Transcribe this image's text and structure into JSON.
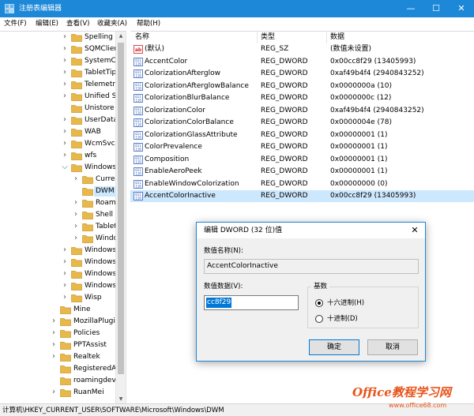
{
  "window": {
    "title": "注册表编辑器",
    "minimize": "—",
    "maximize": "☐",
    "close": "✕"
  },
  "menu": [
    "文件(F)",
    "编辑(E)",
    "查看(V)",
    "收藏夹(A)",
    "帮助(H)"
  ],
  "tree": {
    "items": [
      {
        "label": "Spelling",
        "level": 1,
        "expander": "right"
      },
      {
        "label": "SQMClient",
        "level": 1,
        "expander": "right"
      },
      {
        "label": "SystemCertifi",
        "level": 1,
        "expander": "right"
      },
      {
        "label": "TabletTip",
        "level": 1,
        "expander": "right"
      },
      {
        "label": "TelemetryClie",
        "level": 1,
        "expander": "right"
      },
      {
        "label": "Unified Store",
        "level": 1,
        "expander": "right"
      },
      {
        "label": "Unistore",
        "level": 1,
        "expander": "none"
      },
      {
        "label": "UserData",
        "level": 1,
        "expander": "right"
      },
      {
        "label": "WAB",
        "level": 1,
        "expander": "right"
      },
      {
        "label": "WcmSvc",
        "level": 1,
        "expander": "right"
      },
      {
        "label": "wfs",
        "level": 1,
        "expander": "right"
      },
      {
        "label": "Windows",
        "level": 1,
        "expander": "down"
      },
      {
        "label": "CurrentVe",
        "level": 2,
        "expander": "right"
      },
      {
        "label": "DWM",
        "level": 2,
        "expander": "none",
        "selected": true
      },
      {
        "label": "Roaming",
        "level": 2,
        "expander": "right"
      },
      {
        "label": "Shell",
        "level": 2,
        "expander": "right"
      },
      {
        "label": "TabletPC",
        "level": 2,
        "expander": "right"
      },
      {
        "label": "Windows",
        "level": 2,
        "expander": "right"
      },
      {
        "label": "Windows NT",
        "level": 1,
        "expander": "right"
      },
      {
        "label": "Windows Scr",
        "level": 1,
        "expander": "right"
      },
      {
        "label": "Windows Sea",
        "level": 1,
        "expander": "right"
      },
      {
        "label": "WindowsSelf",
        "level": 1,
        "expander": "right"
      },
      {
        "label": "Wisp",
        "level": 1,
        "expander": "right"
      },
      {
        "label": "Mine",
        "level": 0,
        "expander": "none"
      },
      {
        "label": "MozillaPlugins",
        "level": 0,
        "expander": "right"
      },
      {
        "label": "Policies",
        "level": 0,
        "expander": "right"
      },
      {
        "label": "PPTAssist",
        "level": 0,
        "expander": "right"
      },
      {
        "label": "Realtek",
        "level": 0,
        "expander": "right"
      },
      {
        "label": "RegisteredApplic",
        "level": 0,
        "expander": "none"
      },
      {
        "label": "roamingdevice",
        "level": 0,
        "expander": "none"
      },
      {
        "label": "RuanMei",
        "level": 0,
        "expander": "right"
      }
    ]
  },
  "list": {
    "headers": {
      "name": "名称",
      "type": "类型",
      "data": "数据"
    },
    "rows": [
      {
        "name": "(默认)",
        "type": "REG_SZ",
        "data": "(数值未设置)",
        "icon": "string-value-icon"
      },
      {
        "name": "AccentColor",
        "type": "REG_DWORD",
        "data": "0x00cc8f29 (13405993)",
        "icon": "binary-value-icon"
      },
      {
        "name": "ColorizationAfterglow",
        "type": "REG_DWORD",
        "data": "0xaf49b4f4 (2940843252)",
        "icon": "binary-value-icon"
      },
      {
        "name": "ColorizationAfterglowBalance",
        "type": "REG_DWORD",
        "data": "0x0000000a (10)",
        "icon": "binary-value-icon"
      },
      {
        "name": "ColorizationBlurBalance",
        "type": "REG_DWORD",
        "data": "0x0000000c (12)",
        "icon": "binary-value-icon"
      },
      {
        "name": "ColorizationColor",
        "type": "REG_DWORD",
        "data": "0xaf49b4f4 (2940843252)",
        "icon": "binary-value-icon"
      },
      {
        "name": "ColorizationColorBalance",
        "type": "REG_DWORD",
        "data": "0x0000004e (78)",
        "icon": "binary-value-icon"
      },
      {
        "name": "ColorizationGlassAttribute",
        "type": "REG_DWORD",
        "data": "0x00000001 (1)",
        "icon": "binary-value-icon"
      },
      {
        "name": "ColorPrevalence",
        "type": "REG_DWORD",
        "data": "0x00000001 (1)",
        "icon": "binary-value-icon"
      },
      {
        "name": "Composition",
        "type": "REG_DWORD",
        "data": "0x00000001 (1)",
        "icon": "binary-value-icon"
      },
      {
        "name": "EnableAeroPeek",
        "type": "REG_DWORD",
        "data": "0x00000001 (1)",
        "icon": "binary-value-icon"
      },
      {
        "name": "EnableWindowColorization",
        "type": "REG_DWORD",
        "data": "0x00000000 (0)",
        "icon": "binary-value-icon"
      },
      {
        "name": "AccentColorInactive",
        "type": "REG_DWORD",
        "data": "0x00cc8f29 (13405993)",
        "icon": "binary-value-icon",
        "selected": true
      }
    ]
  },
  "status": {
    "path": "计算机\\HKEY_CURRENT_USER\\SOFTWARE\\Microsoft\\Windows\\DWM"
  },
  "watermark": {
    "logo": "Office教程学习网",
    "url": "www.office68.com"
  },
  "dialog": {
    "title": "编辑 DWORD (32 位)值",
    "close": "✕",
    "name_label": "数值名称(N):",
    "name_value": "AccentColorInactive",
    "data_label": "数值数据(V):",
    "data_value": "cc8f29",
    "base_label": "基数",
    "radio_hex": "十六进制(H)",
    "radio_dec": "十进制(D)",
    "hex_selected": true,
    "ok": "确定",
    "cancel": "取消"
  },
  "colors": {
    "titlebar": "#1e88d8",
    "selection": "#cce8ff",
    "text_selection": "#0078d7",
    "folder": "#e8b84a",
    "string_icon": "#d0202a",
    "binary_icon": "#3a63b8",
    "watermark": "#e8541a"
  }
}
